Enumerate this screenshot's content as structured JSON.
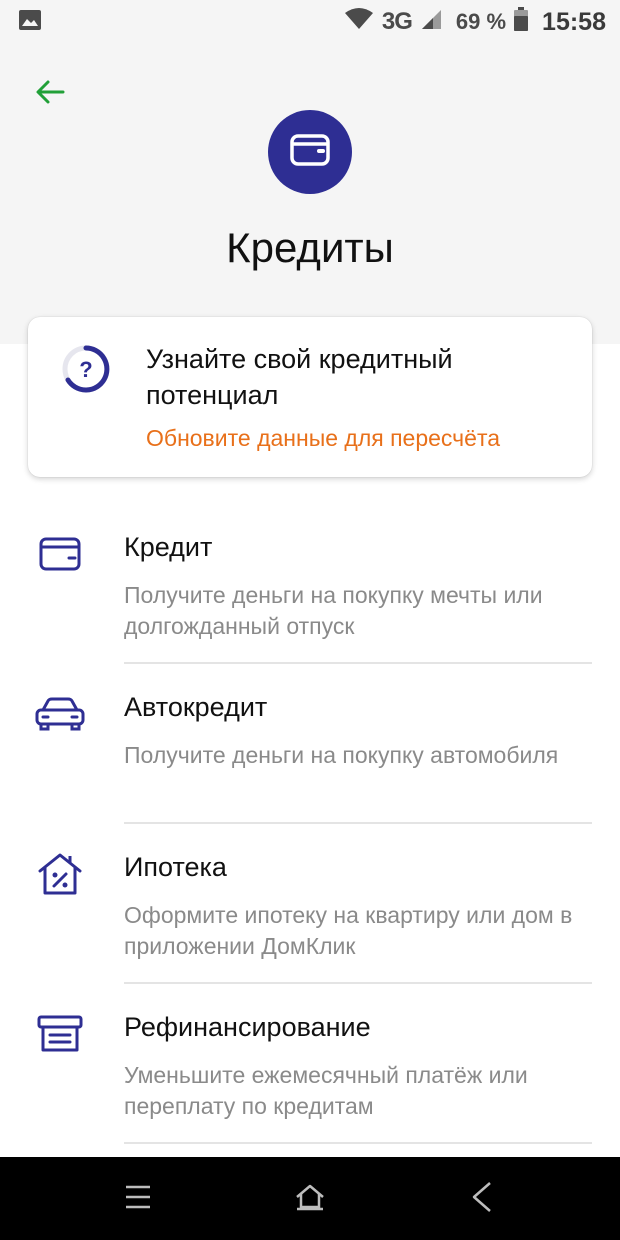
{
  "status_bar": {
    "network": "3G",
    "battery": "69 %",
    "time": "15:58",
    "icons": [
      "image-icon",
      "wifi-icon",
      "signal-icon",
      "battery-icon"
    ]
  },
  "header": {
    "back_icon": "arrow-left-icon",
    "title": "Кредиты",
    "icon": "wallet-icon"
  },
  "potential_card": {
    "title": "Узнайте свой кредитный потенциал",
    "link": "Обновите данные для пересчёта",
    "icon": "question-progress-icon"
  },
  "products": [
    {
      "title": "Кредит",
      "description": "Получите деньги на покупку мечты или долгожданный отпуск",
      "icon": "wallet-icon"
    },
    {
      "title": "Автокредит",
      "description": "Получите деньги на покупку автомобиля",
      "icon": "car-icon"
    },
    {
      "title": "Ипотека",
      "description": "Оформите ипотеку на квартиру или дом в приложении ДомКлик",
      "icon": "house-percent-icon"
    },
    {
      "title": "Рефинансирование",
      "description": "Уменьшите ежемесячный платёж или переплату по кредитам",
      "icon": "refinance-icon"
    }
  ],
  "nav_bar": {
    "icons": [
      "menu-icon",
      "home-icon",
      "back-icon"
    ]
  },
  "colors": {
    "accent_green": "#21a038",
    "brand_indigo": "#2e2e93",
    "link_orange": "#e8701a",
    "header_bg": "#f5f5f5"
  }
}
